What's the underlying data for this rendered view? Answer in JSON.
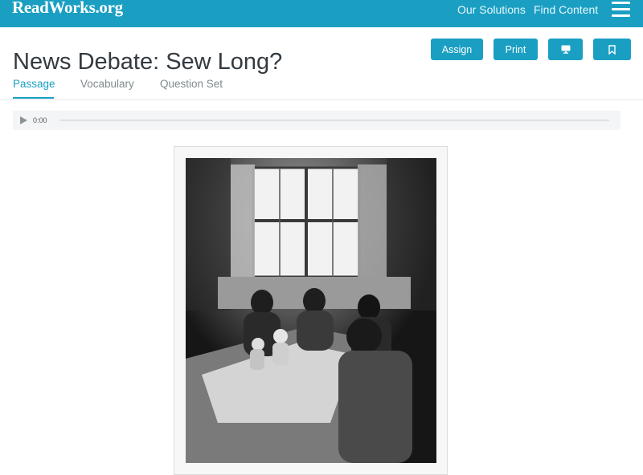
{
  "header": {
    "logo": "ReadWorks.org",
    "nav": [
      "Our Solutions",
      "Find Content"
    ],
    "menu_icon": "hamburger-menu-icon"
  },
  "page": {
    "title": "News Debate: Sew Long?"
  },
  "actions": {
    "assign": "Assign",
    "print": "Print",
    "present_icon": "monitor-icon",
    "bookmark_icon": "bookmark-icon"
  },
  "tabs": [
    {
      "label": "Passage",
      "active": true
    },
    {
      "label": "Vocabulary",
      "active": false
    },
    {
      "label": "Question Set",
      "active": false
    }
  ],
  "audio": {
    "time": "0:00",
    "progress": 0
  },
  "colors": {
    "brand": "#1a9fc3",
    "title_text": "#333a40",
    "tab_inactive": "#7f8a90"
  },
  "image": {
    "type": "black-and-white photograph"
  }
}
